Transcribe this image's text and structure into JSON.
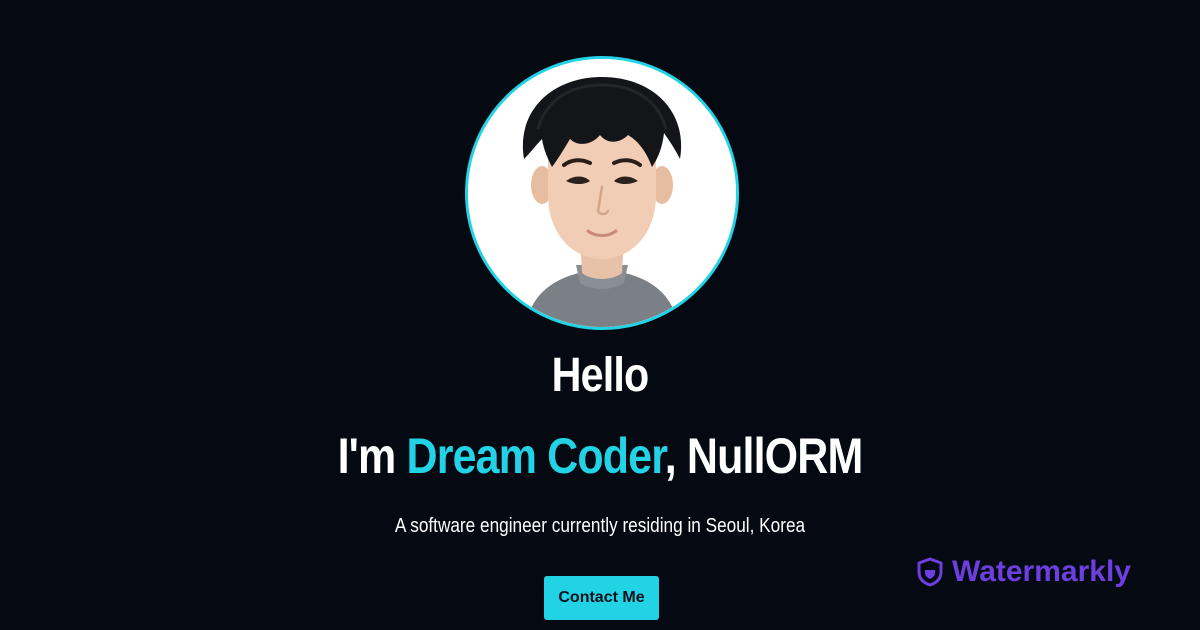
{
  "hero": {
    "greeting": "Hello",
    "intro_prefix": "I'm ",
    "intro_accent": "Dream Coder",
    "intro_suffix": ", NullORM",
    "tagline": "A software engineer currently residing in Seoul, Korea",
    "contact_label": "Contact Me"
  },
  "watermark": {
    "text": "Watermarkly",
    "icon": "shield-icon"
  },
  "colors": {
    "background": "#050a12",
    "accent": "#22d3e6",
    "watermark": "#6d3fe0"
  }
}
